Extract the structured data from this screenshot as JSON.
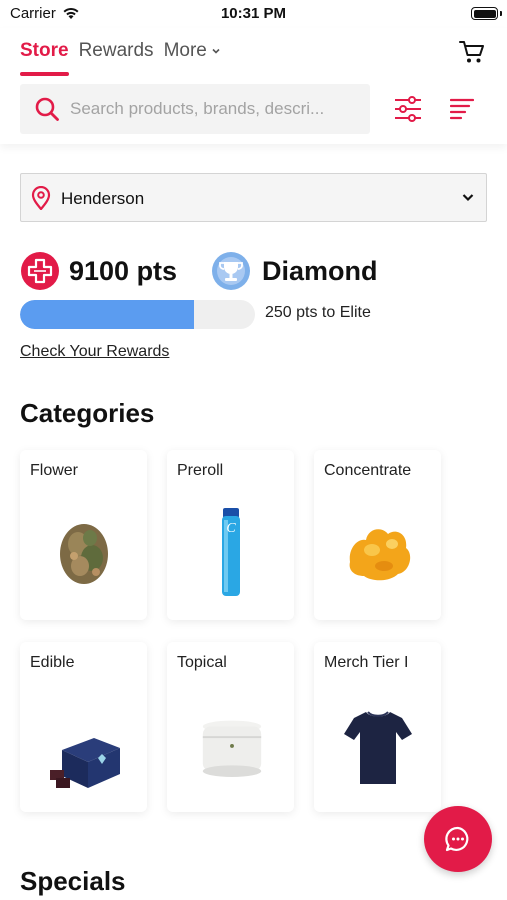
{
  "status_bar": {
    "carrier": "Carrier",
    "time": "10:31 PM"
  },
  "nav": {
    "tabs": [
      "Store",
      "Rewards",
      "More"
    ],
    "active_tab": "Store"
  },
  "search": {
    "placeholder": "Search products, brands, descri..."
  },
  "location": {
    "selected": "Henderson"
  },
  "rewards": {
    "points": "9100 pts",
    "tier": "Diamond",
    "progress_label": "250 pts to Elite",
    "progress_fraction": 0.74,
    "check_link": "Check Your Rewards"
  },
  "categories": {
    "title": "Categories",
    "items": [
      {
        "label": "Flower",
        "image": "flower-image"
      },
      {
        "label": "Preroll",
        "image": "preroll-tube-image"
      },
      {
        "label": "Concentrate",
        "image": "concentrate-image"
      },
      {
        "label": "Edible",
        "image": "edible-box-image"
      },
      {
        "label": "Topical",
        "image": "topical-jar-image"
      },
      {
        "label": "Merch Tier I",
        "image": "tshirt-image"
      }
    ]
  },
  "specials": {
    "title": "Specials"
  },
  "colors": {
    "brand": "#e21b48",
    "progress": "#5b9cf0",
    "tier_badge": "#7eb0ea"
  }
}
